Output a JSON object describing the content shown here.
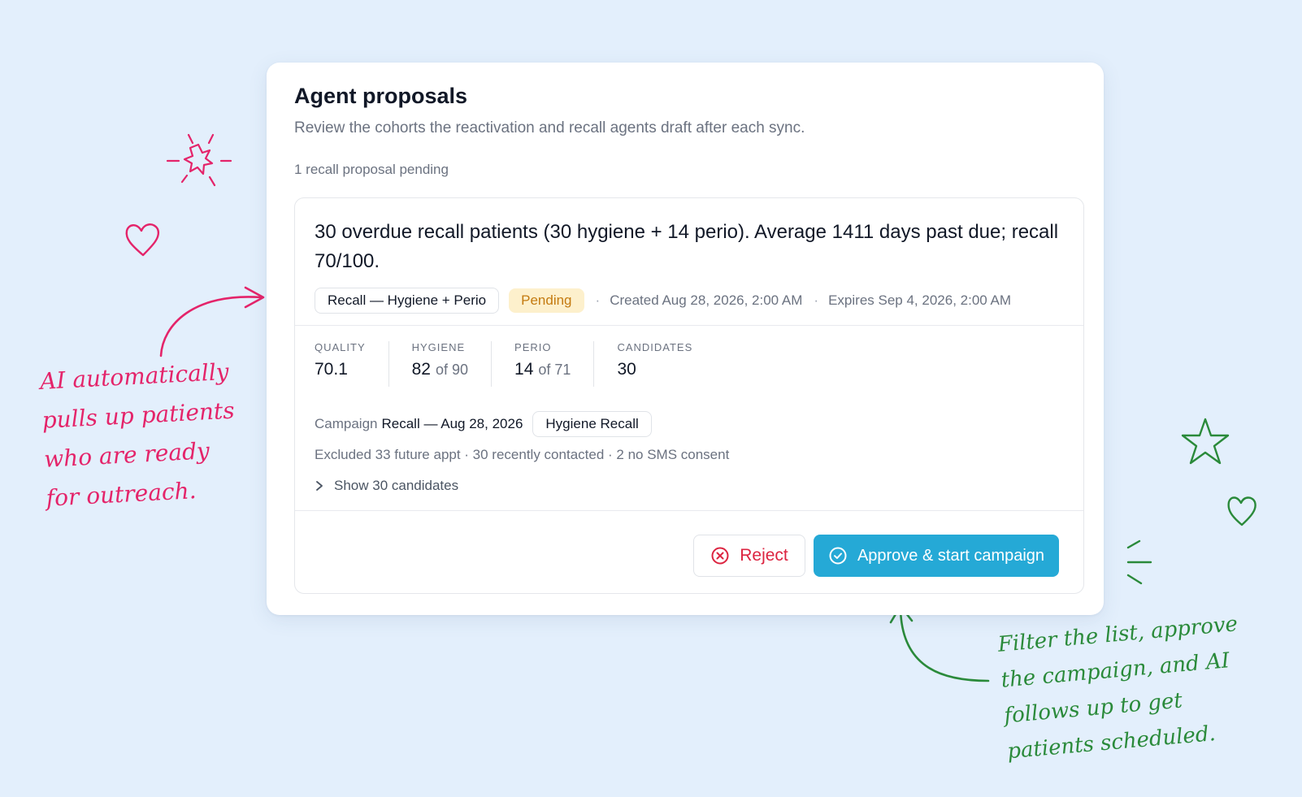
{
  "panel": {
    "title": "Agent proposals",
    "subtitle": "Review the cohorts the reactivation and recall agents draft after each sync.",
    "pending_count": "1 recall proposal pending"
  },
  "proposal": {
    "summary": "30 overdue recall patients (30 hygiene + 14 perio). Average 1411 days past due; recall 70/100.",
    "type_chip": "Recall — Hygiene + Perio",
    "status": "Pending",
    "created": "Created Aug 28, 2026, 2:00 AM",
    "expires": "Expires Sep 4, 2026, 2:00 AM",
    "separator": "·",
    "stats": {
      "quality": {
        "label": "QUALITY",
        "value": "70.1"
      },
      "hygiene": {
        "label": "HYGIENE",
        "value": "82",
        "of": "of 90"
      },
      "perio": {
        "label": "PERIO",
        "value": "14",
        "of": "of 71"
      },
      "candidates": {
        "label": "CANDIDATES",
        "value": "30"
      }
    },
    "campaign_label": "Campaign",
    "campaign_value": "Recall — Aug 28, 2026",
    "campaign_chip": "Hygiene Recall",
    "excluded": "Excluded 33 future appt · 30 recently contacted · 2 no SMS consent",
    "show_candidates": "Show 30 candidates",
    "reject_label": "Reject",
    "approve_label": "Approve & start campaign"
  },
  "annotations": {
    "left": [
      "AI automatically",
      "pulls up patients",
      "who are ready",
      "for outreach."
    ],
    "right": [
      "Filter the list, approve",
      "the campaign, and AI",
      "follows up to get",
      "patients scheduled."
    ]
  },
  "colors": {
    "background": "#e3effc",
    "accent": "#25a9d6",
    "reject": "#dc2440",
    "pending_bg": "#fdf0cc",
    "pending_text": "#c47a10",
    "note_pink": "#e4246a",
    "note_green": "#2a8a3a"
  }
}
